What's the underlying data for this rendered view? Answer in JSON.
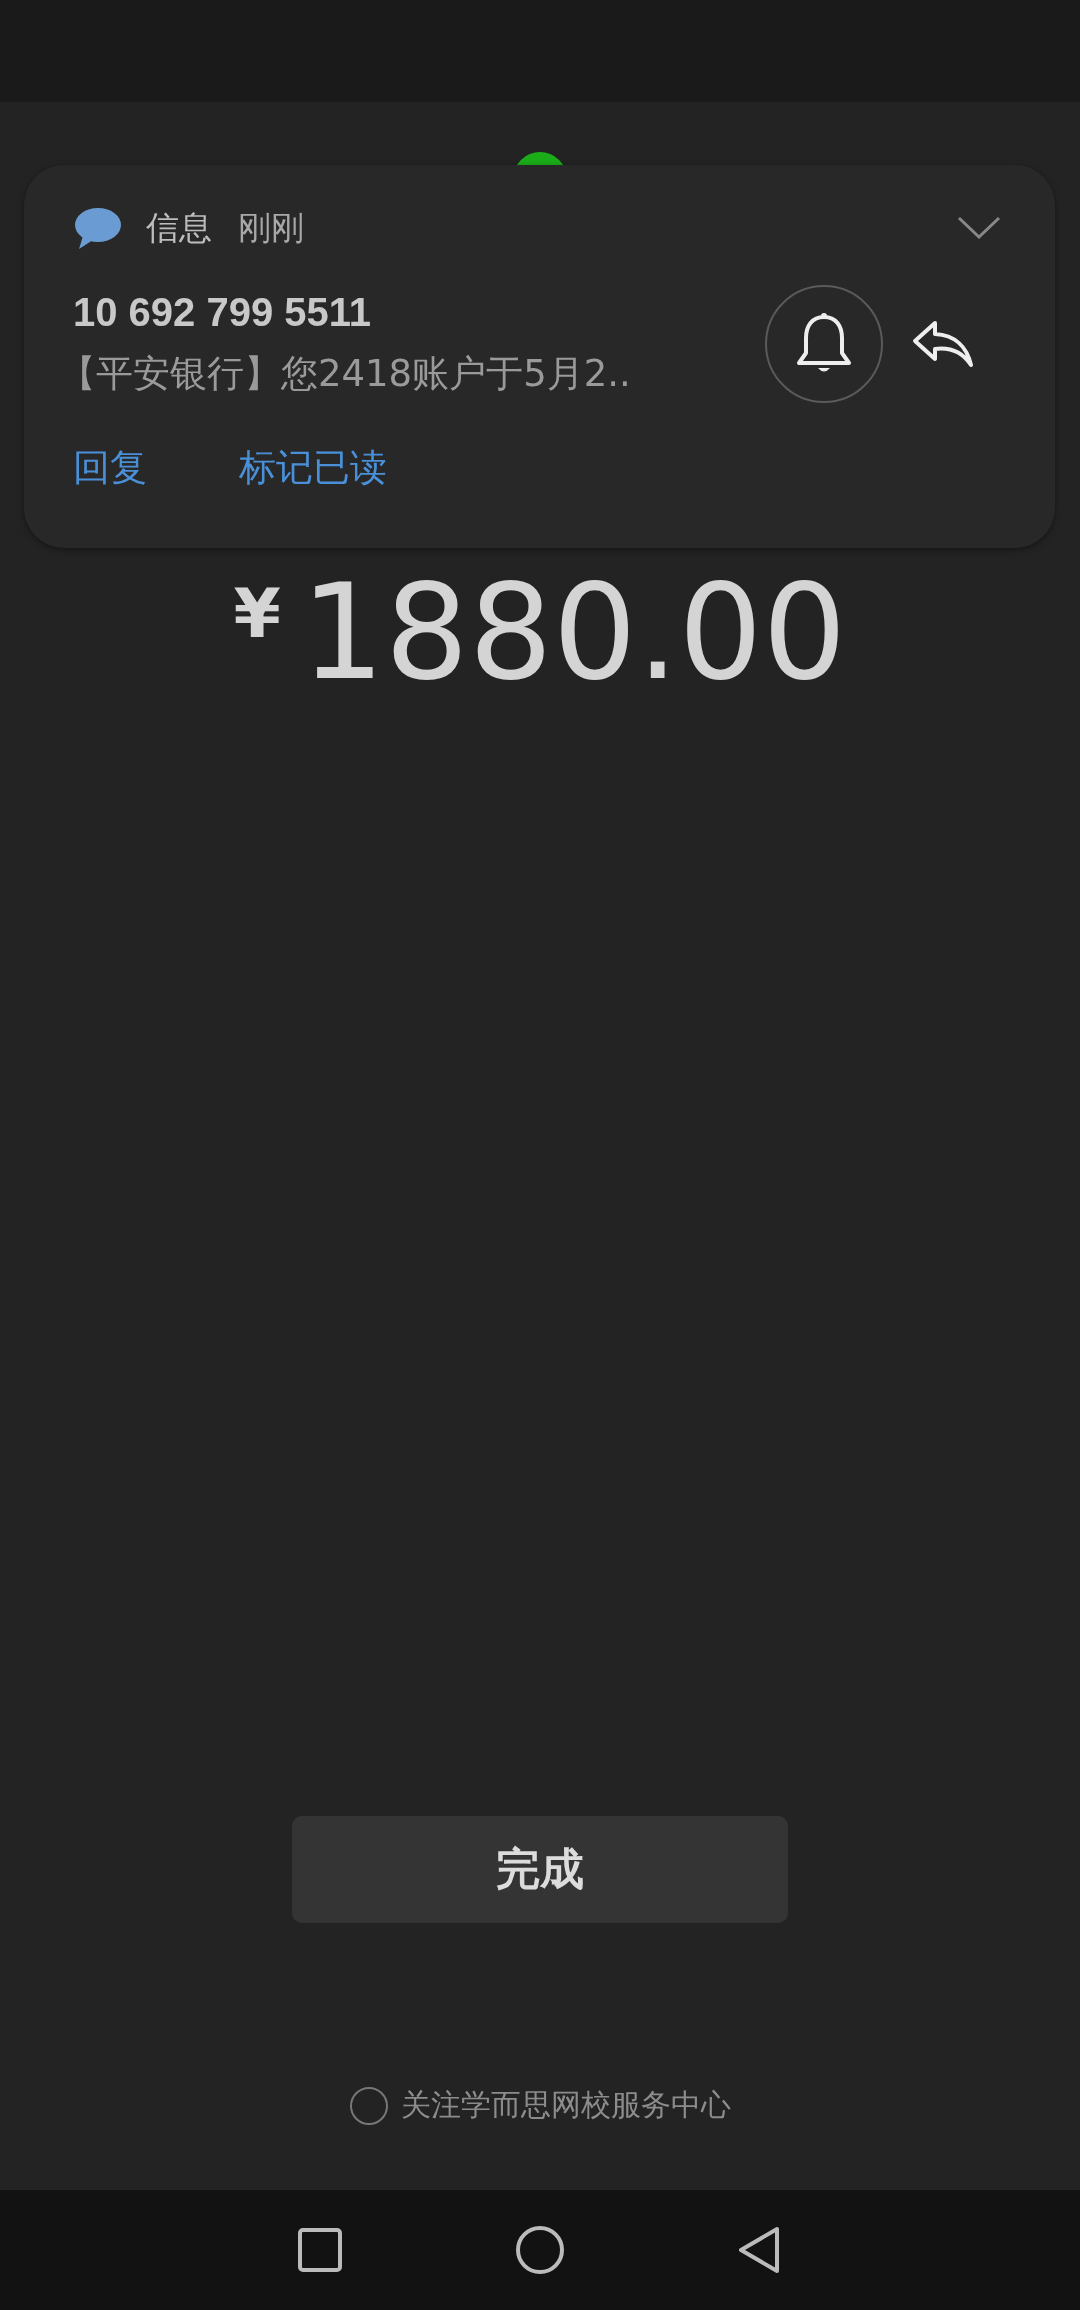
{
  "notification": {
    "app": "信息",
    "time": "刚刚",
    "sender": "10 692 799 5511",
    "message": "【平安银行】您2418账户于5月2..",
    "actions": [
      "回复",
      "标记已读"
    ]
  },
  "payment": {
    "currency": "¥",
    "amount": "1880.00"
  },
  "done_button": "完成",
  "follow": {
    "label": "关注学而思网校服务中心",
    "checked": false
  }
}
